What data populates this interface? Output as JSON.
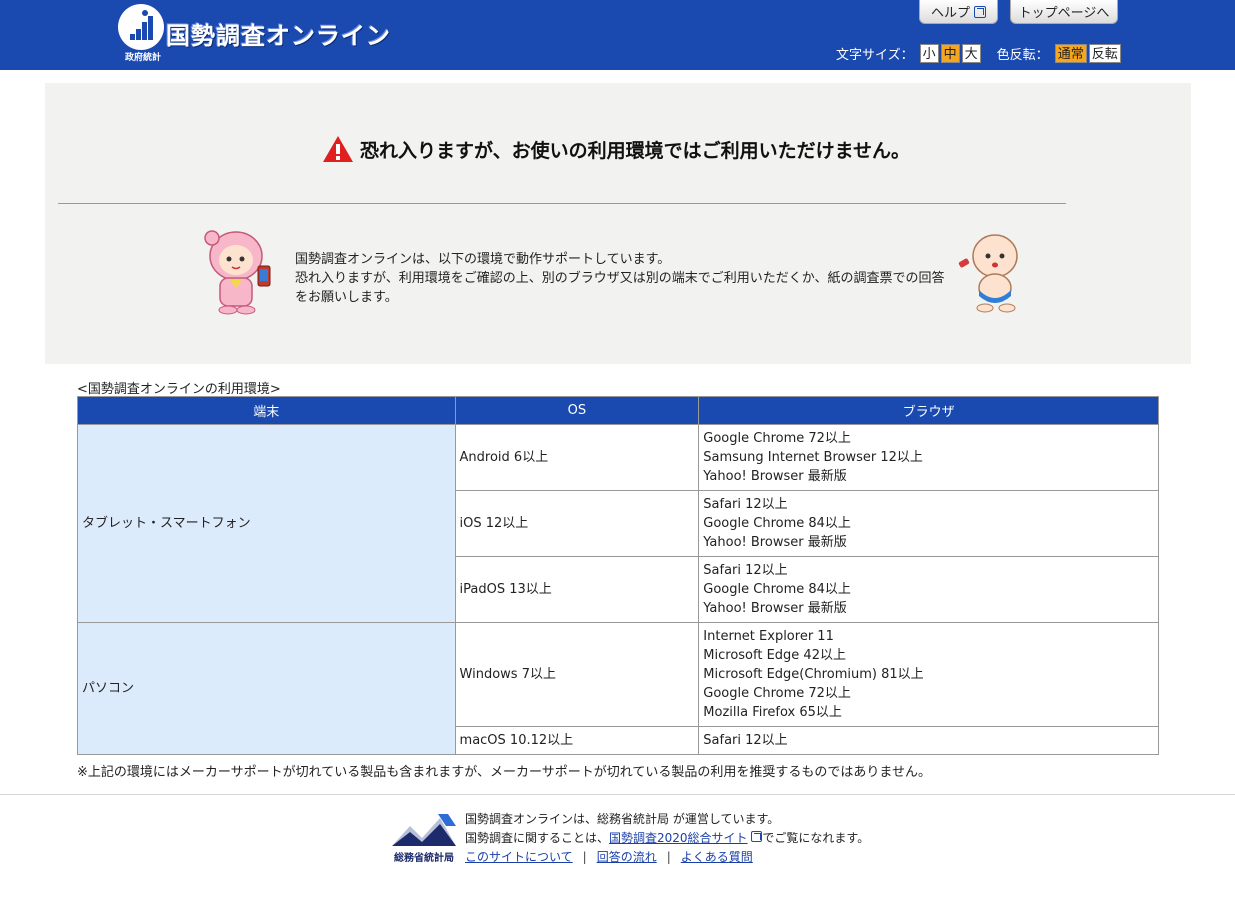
{
  "header": {
    "logo_sub": "政府統計",
    "title": "国勢調査オンライン",
    "help_label": "ヘルプ",
    "top_label": "トップページへ",
    "font_size_label": "文字サイズ：",
    "font_sizes": [
      "小",
      "中",
      "大"
    ],
    "color_label": "色反転：",
    "color_modes": [
      "通常",
      "反転"
    ],
    "brand_color": "#1a49b0",
    "active_color": "#f5a51e"
  },
  "notice": {
    "title": "恐れ入りますが、お使いの利用環境ではご利用いただけません。",
    "line1": "国勢調査オンラインは、以下の環境で動作サポートしています。",
    "line2": "恐れ入りますが、利用環境をご確認の上、別のブラウザ又は別の端末でご利用いただくか、紙の調査票での回答をお願いします。"
  },
  "env": {
    "caption": "<国勢調査オンラインの利用環境>",
    "headers": [
      "端末",
      "OS",
      "ブラウザ"
    ],
    "groups": [
      {
        "device": "タブレット・スマートフォン",
        "rows": [
          {
            "os": "Android 6以上",
            "browsers": [
              "Google Chrome 72以上",
              "Samsung Internet Browser 12以上",
              "Yahoo! Browser 最新版"
            ]
          },
          {
            "os": "iOS 12以上",
            "browsers": [
              "Safari 12以上",
              "Google Chrome 84以上",
              "Yahoo! Browser 最新版"
            ]
          },
          {
            "os": "iPadOS 13以上",
            "browsers": [
              "Safari 12以上",
              "Google Chrome 84以上",
              "Yahoo! Browser 最新版"
            ]
          }
        ]
      },
      {
        "device": "パソコン",
        "rows": [
          {
            "os": "Windows 7以上",
            "browsers": [
              "Internet Explorer 11",
              "Microsoft Edge 42以上",
              "Microsoft Edge(Chromium) 81以上",
              "Google Chrome 72以上",
              "Mozilla Firefox 65以上"
            ]
          },
          {
            "os": "macOS 10.12以上",
            "browsers": [
              "Safari 12以上"
            ]
          }
        ]
      }
    ],
    "note": "※上記の環境にはメーカーサポートが切れている製品も含まれますが、メーカーサポートが切れている製品の利用を推奨するものではありません。",
    "device_bg": "#dcebfb"
  },
  "footer": {
    "logo_label": "総務省統計局",
    "line1": "国勢調査オンラインは、総務省統計局 が運営しています。",
    "line2_pre": "国勢調査に関することは、",
    "line2_link": "国勢調査2020総合サイト",
    "line2_post": "でご覧になれます。",
    "links": [
      "このサイトについて",
      "回答の流れ",
      "よくある質問"
    ]
  }
}
